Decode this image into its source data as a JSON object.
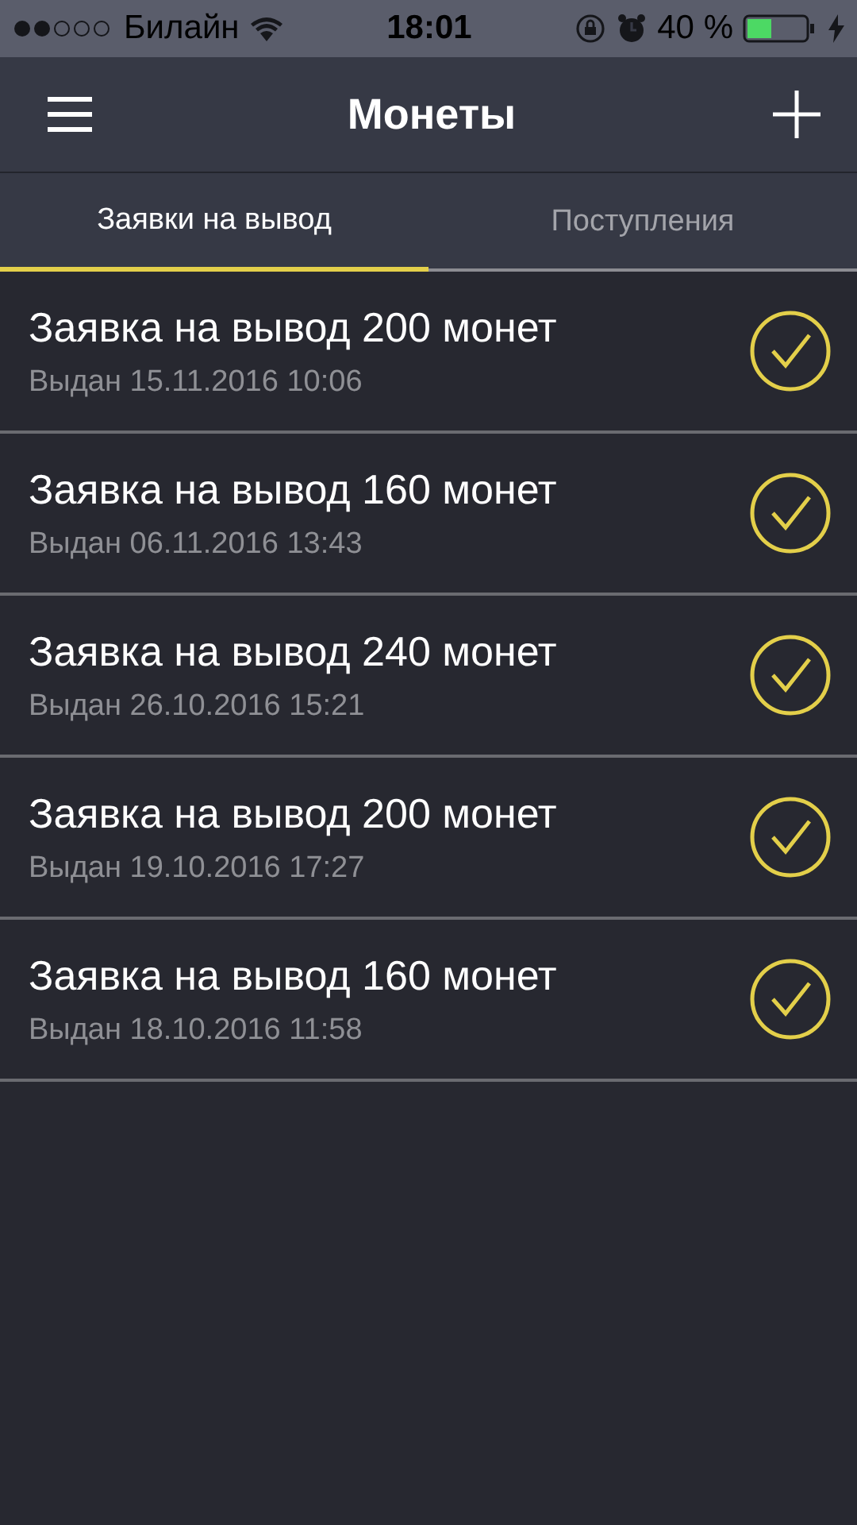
{
  "status_bar": {
    "carrier": "Билайн",
    "time": "18:01",
    "battery": "40 %"
  },
  "nav": {
    "title": "Монеты"
  },
  "tabs": [
    {
      "label": "Заявки на вывод",
      "selected": true
    },
    {
      "label": "Поступления",
      "selected": false
    }
  ],
  "requests": [
    {
      "title": "Заявка на вывод 200 монет",
      "date": "Выдан 15.11.2016 10:06",
      "approved": true
    },
    {
      "title": "Заявка на вывод 160 монет",
      "date": "Выдан 06.11.2016 13:43",
      "approved": true
    },
    {
      "title": "Заявка на вывод 240 монет",
      "date": "Выдан 26.10.2016 15:21",
      "approved": true
    },
    {
      "title": "Заявка на вывод 200 монет",
      "date": "Выдан 19.10.2016 17:27",
      "approved": true
    },
    {
      "title": "Заявка на вывод 160 монет",
      "date": "Выдан 18.10.2016 11:58",
      "approved": true
    }
  ]
}
